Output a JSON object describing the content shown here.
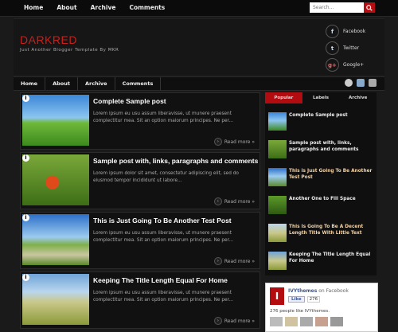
{
  "top_nav": [
    "Home",
    "About",
    "Archive",
    "Comments"
  ],
  "search": {
    "placeholder": "Search..."
  },
  "blog": {
    "title": "DARKRED",
    "description": "Just Another Blogger Template By MKR"
  },
  "social": [
    {
      "icon": "facebook-icon",
      "glyph": "f",
      "label": "Facebook"
    },
    {
      "icon": "twitter-icon",
      "glyph": "t",
      "label": "Twitter"
    },
    {
      "icon": "google-plus-icon",
      "glyph": "g+",
      "label": "Google+"
    }
  ],
  "main_nav": [
    "Home",
    "About",
    "Archive",
    "Comments"
  ],
  "posts": [
    {
      "title": "Complete Sample post",
      "excerpt": "Lorem ipsum eu usu assum liberavisse, ut munere praesent complectitur mea. Sit an option maiorum principes. Ne per...",
      "read_more": "Read more »"
    },
    {
      "title": "Sample post with, links, paragraphs and comments",
      "excerpt": "Lorem ipsum dolor sit amet, consectetur adipiscing elit, sed do eiusmod tempor incididunt ut labore...",
      "read_more": "Read more »"
    },
    {
      "title": "This is Just Going To Be Another Test Post",
      "excerpt": "Lorem ipsum eu usu assum liberavisse, ut munere praesent complectitur mea. Sit an option maiorum principes. Ne per...",
      "read_more": "Read more »"
    },
    {
      "title": "Keeping The Title Length Equal For Home",
      "excerpt": "Lorem ipsum eu usu assum liberavisse, ut munere praesent complectitur mea. Sit an option maiorum principes. Ne per...",
      "read_more": "Read more »"
    }
  ],
  "sidebar": {
    "tabs": [
      "Popular",
      "Labels",
      "Archive"
    ],
    "items": [
      "Complete Sample post",
      "Sample post with, links, paragraphs and comments",
      "This is Just Going To Be Another Test Post",
      "Another One to Fill Space",
      "This Is Going To Be A Decent Length Title With Little Text",
      "Keeping The Title Length Equal For Home"
    ]
  },
  "facebook_box": {
    "page_name": "IVYthemes",
    "on": "on Facebook",
    "like": "Like",
    "like_count": "276",
    "people_text": "276 people like IVYthemes."
  },
  "colors": {
    "accent": "#b20c10",
    "background": "#1a1a1a"
  }
}
